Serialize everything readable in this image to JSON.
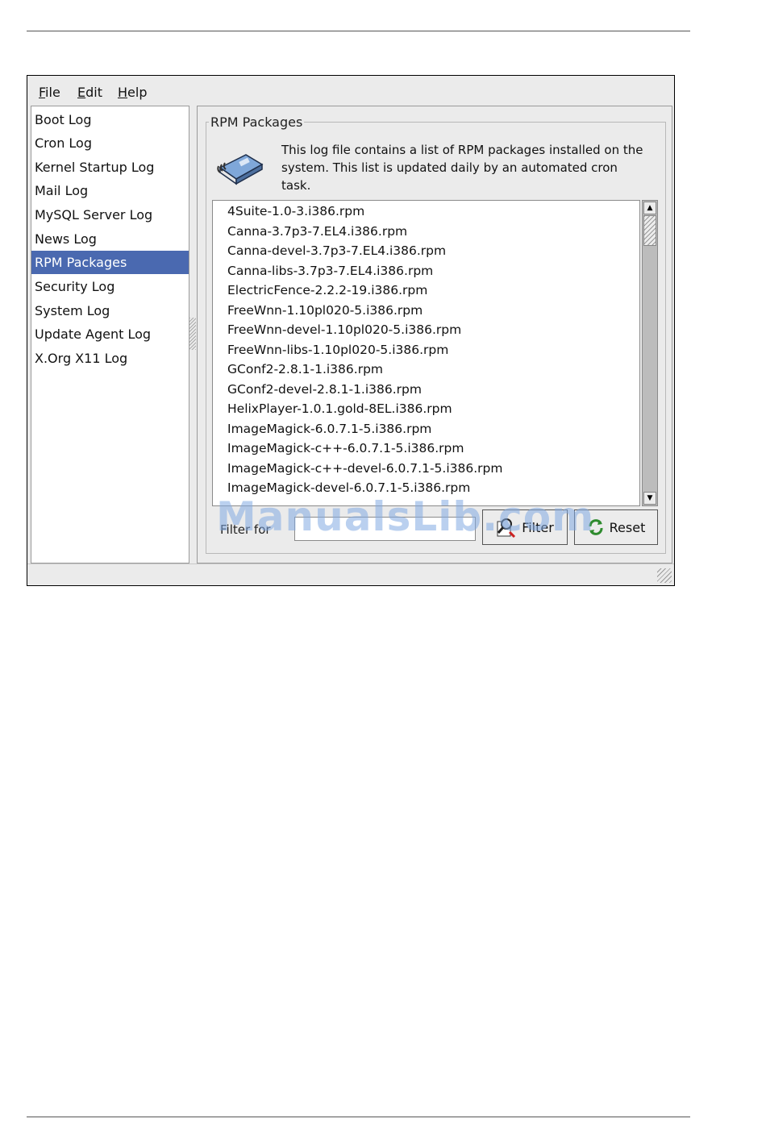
{
  "menu": [
    {
      "mnemonic": "F",
      "rest": "ile"
    },
    {
      "mnemonic": "E",
      "rest": "dit"
    },
    {
      "mnemonic": "H",
      "rest": "elp"
    }
  ],
  "sidebar": {
    "items": [
      {
        "label": "Boot Log"
      },
      {
        "label": "Cron Log"
      },
      {
        "label": "Kernel Startup Log"
      },
      {
        "label": "Mail Log"
      },
      {
        "label": "MySQL Server Log"
      },
      {
        "label": "News Log"
      },
      {
        "label": "RPM Packages",
        "selected": true
      },
      {
        "label": "Security Log"
      },
      {
        "label": "System Log"
      },
      {
        "label": "Update Agent Log"
      },
      {
        "label": "X.Org X11 Log"
      }
    ]
  },
  "main": {
    "frame_title": "RPM Packages",
    "description": "This log file contains a list of RPM packages installed on the system. This list is updated daily by an automated cron task.",
    "icon": "book-icon",
    "packages": [
      "4Suite-1.0-3.i386.rpm",
      "Canna-3.7p3-7.EL4.i386.rpm",
      "Canna-devel-3.7p3-7.EL4.i386.rpm",
      "Canna-libs-3.7p3-7.EL4.i386.rpm",
      "ElectricFence-2.2.2-19.i386.rpm",
      "FreeWnn-1.10pl020-5.i386.rpm",
      "FreeWnn-devel-1.10pl020-5.i386.rpm",
      "FreeWnn-libs-1.10pl020-5.i386.rpm",
      "GConf2-2.8.1-1.i386.rpm",
      "GConf2-devel-2.8.1-1.i386.rpm",
      "HelixPlayer-1.0.1.gold-8EL.i386.rpm",
      "ImageMagick-6.0.7.1-5.i386.rpm",
      "ImageMagick-c++-6.0.7.1-5.i386.rpm",
      "ImageMagick-c++-devel-6.0.7.1-5.i386.rpm",
      "ImageMagick-devel-6.0.7.1-5.i386.rpm"
    ],
    "filter_label": "Filter for",
    "filter_value": "",
    "filter_button": "Filter",
    "reset_button": "Reset"
  },
  "watermark": "ManualsLib.com",
  "colors": {
    "selection": "#4a69b0",
    "window_bg": "#ebebeb"
  }
}
